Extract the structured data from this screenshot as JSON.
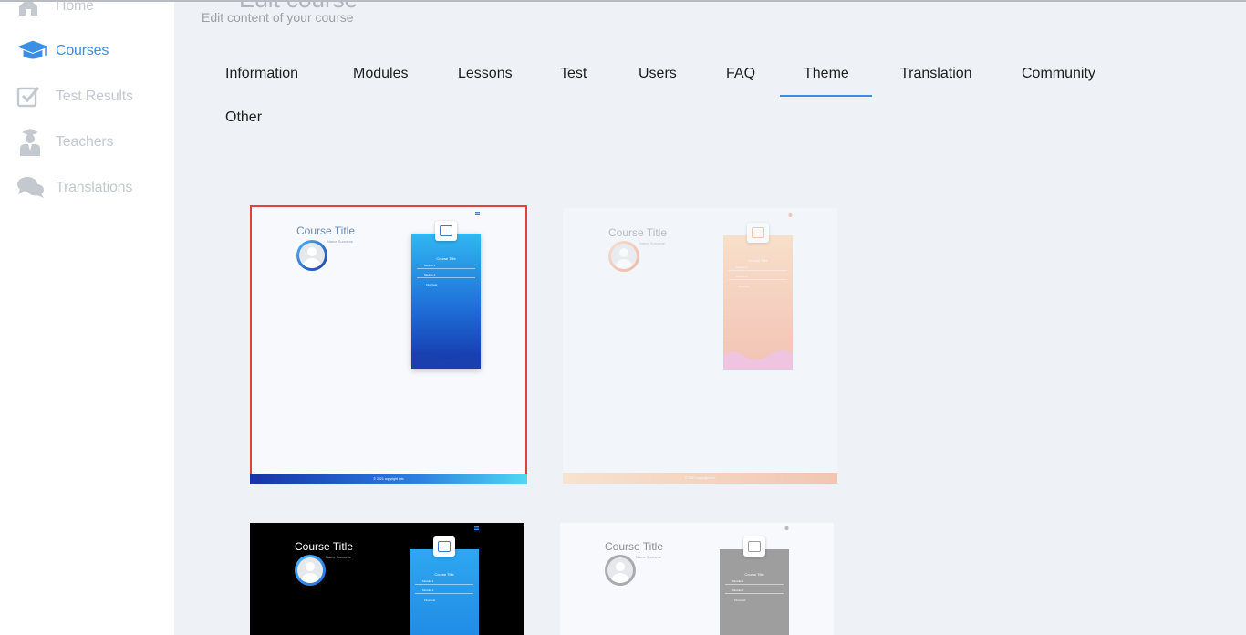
{
  "sidebar": {
    "items": [
      {
        "label": "Home",
        "icon": "home-icon"
      },
      {
        "label": "Courses",
        "icon": "graduation-cap-icon",
        "active": true
      },
      {
        "label": "Test Results",
        "icon": "checkbox-icon"
      },
      {
        "label": "Teachers",
        "icon": "teacher-icon"
      },
      {
        "label": "Translations",
        "icon": "chat-bubbles-icon"
      }
    ]
  },
  "header": {
    "title": "Edit course",
    "subtitle": "Edit content of your course"
  },
  "tabs": [
    {
      "label": "Information"
    },
    {
      "label": "Modules"
    },
    {
      "label": "Lessons"
    },
    {
      "label": "Test"
    },
    {
      "label": "Users"
    },
    {
      "label": "FAQ"
    },
    {
      "label": "Theme",
      "active": true
    },
    {
      "label": "Translation"
    },
    {
      "label": "Community"
    },
    {
      "label": "Other"
    }
  ],
  "themes": [
    {
      "course_title": "Course Title",
      "name": "Name Surname",
      "phone_title": "Course Title",
      "modules": [
        "Module 1",
        "Module 2",
        "Final test"
      ],
      "footer": "© 2021 copyright info",
      "selected": true,
      "accent": "#2f6fd8"
    },
    {
      "course_title": "Course Title",
      "name": "Name Surname",
      "phone_title": "Course Title",
      "modules": [
        "Module 1",
        "Module 2",
        "Final test"
      ],
      "footer": "© 2021 copyright info",
      "selected": false,
      "accent": "#f5a37d"
    },
    {
      "course_title": "Course Title",
      "name": "Name Surname",
      "phone_title": "Course Title",
      "modules": [
        "Module 1",
        "Module 2",
        "Final test"
      ],
      "footer": "",
      "selected": false,
      "accent": "#1e88e5"
    },
    {
      "course_title": "Course Title",
      "name": "Name Surname",
      "phone_title": "Course Title",
      "modules": [
        "Module 1",
        "Module 2",
        "Final test"
      ],
      "footer": "",
      "selected": false,
      "accent": "#9e9e9e"
    }
  ],
  "colors": {
    "accent": "#3a8ee6",
    "selection": "#e2423a",
    "background": "#eef2f6"
  }
}
